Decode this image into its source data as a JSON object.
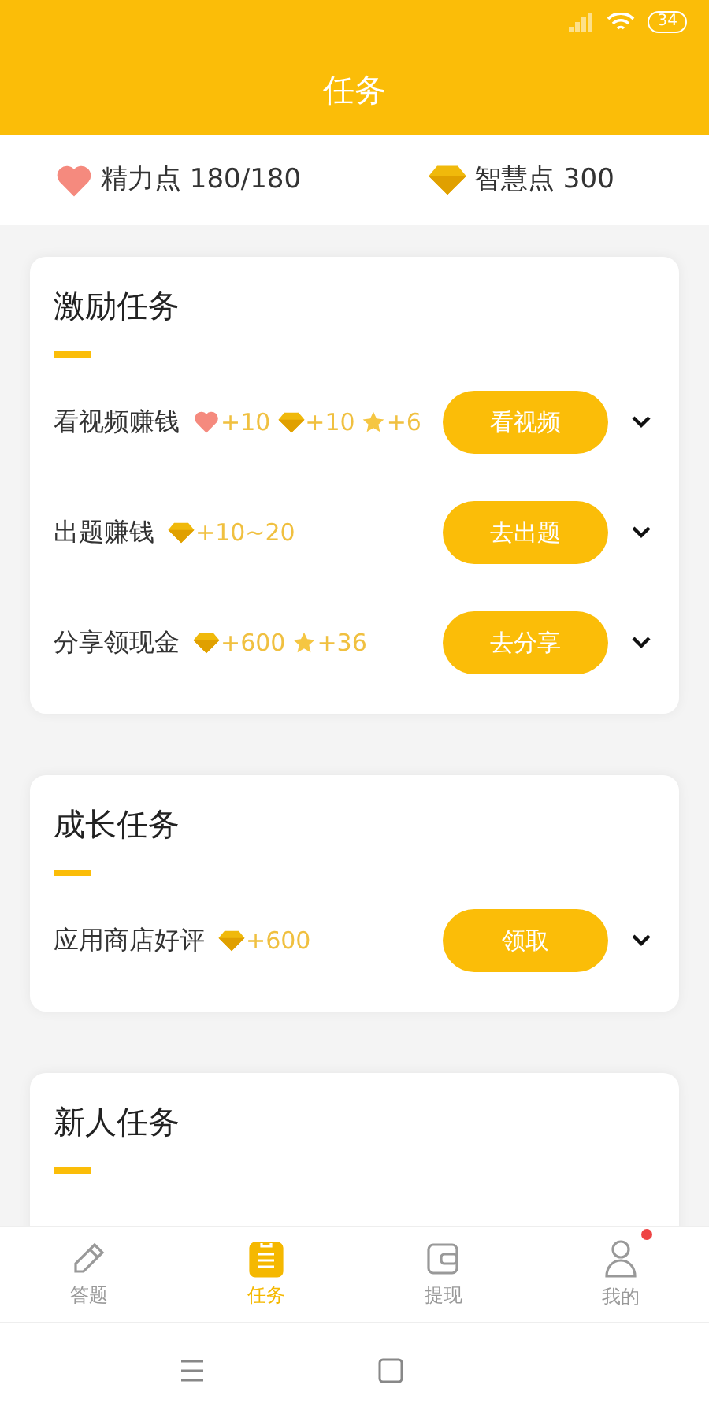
{
  "status_bar": {
    "battery": "34"
  },
  "header": {
    "title": "任务"
  },
  "stats": [
    {
      "kind": "heart",
      "label": "精力点 180/180"
    },
    {
      "kind": "diamond",
      "label": "智慧点 300"
    }
  ],
  "sections": [
    {
      "title": "激励任务",
      "tasks": [
        {
          "name": "看视频赚钱",
          "rewards": [
            {
              "kind": "heart",
              "text": "+10"
            },
            {
              "kind": "diamond",
              "text": "+10"
            },
            {
              "kind": "star",
              "text": "+6"
            }
          ],
          "button": "看视频"
        },
        {
          "name": "出题赚钱",
          "rewards": [
            {
              "kind": "diamond",
              "text": "+10~20"
            }
          ],
          "button": "去出题"
        },
        {
          "name": "分享领现金",
          "rewards": [
            {
              "kind": "diamond",
              "text": "+600"
            },
            {
              "kind": "star",
              "text": "+36"
            }
          ],
          "button": "去分享"
        }
      ]
    },
    {
      "title": "成长任务",
      "tasks": [
        {
          "name": "应用商店好评",
          "rewards": [
            {
              "kind": "diamond",
              "text": "+600"
            }
          ],
          "button": "领取"
        }
      ]
    },
    {
      "title": "新人任务"
    }
  ],
  "tab_bar": [
    {
      "kind": "pencil",
      "label": "答题",
      "selected": false,
      "badge": false
    },
    {
      "kind": "clipboard",
      "label": "任务",
      "selected": true,
      "badge": false
    },
    {
      "kind": "wallet",
      "label": "提现",
      "selected": false,
      "badge": false
    },
    {
      "kind": "person",
      "label": "我的",
      "selected": false,
      "badge": true
    }
  ]
}
